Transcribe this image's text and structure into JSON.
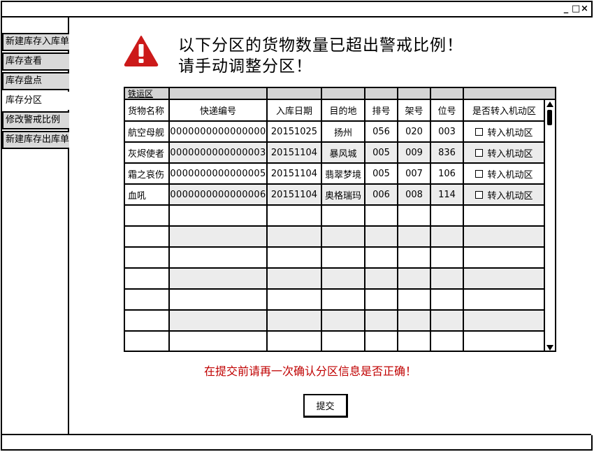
{
  "window": {
    "controls": {
      "minimize": "_",
      "maximize": "□",
      "close": "×"
    }
  },
  "sidebar": {
    "items": [
      {
        "label": "新建库存入库单",
        "active": false
      },
      {
        "label": "库存查看",
        "active": false
      },
      {
        "label": "库存盘点",
        "active": false
      },
      {
        "label": "库存分区",
        "active": true
      },
      {
        "label": "修改警戒比例",
        "active": false
      },
      {
        "label": "新建库存出库单",
        "active": false
      }
    ]
  },
  "alert": {
    "icon": "warning-icon",
    "icon_color": "#cc1a1a",
    "line1": "以下分区的货物数量已超出警戒比例！",
    "line2": "请手动调整分区！"
  },
  "table": {
    "region_label": "铁运区",
    "headers": [
      "货物名称",
      "快递编号",
      "入库日期",
      "目的地",
      "排号",
      "架号",
      "位号",
      "是否转入机动区"
    ],
    "rows": [
      {
        "name": "航空母舰",
        "code": "0000000000000000",
        "date": "20151025",
        "dest": "扬州",
        "row": "056",
        "shelf": "020",
        "pos": "003",
        "move_label": "转入机动区",
        "checked": false
      },
      {
        "name": "灰烬使者",
        "code": "0000000000000003",
        "date": "20151104",
        "dest": "暴风城",
        "row": "005",
        "shelf": "009",
        "pos": "836",
        "move_label": "转入机动区",
        "checked": false
      },
      {
        "name": "霜之哀伤",
        "code": "0000000000000005",
        "date": "20151104",
        "dest": "翡翠梦境",
        "row": "005",
        "shelf": "007",
        "pos": "106",
        "move_label": "转入机动区",
        "checked": false
      },
      {
        "name": "血吼",
        "code": "0000000000000006",
        "date": "20151104",
        "dest": "奥格瑞玛",
        "row": "006",
        "shelf": "008",
        "pos": "114",
        "move_label": "转入机动区",
        "checked": false
      }
    ],
    "empty_rows": 7,
    "alt_row_color": "#ececec"
  },
  "confirm_note": "在提交前请再一次确认分区信息是否正确！",
  "confirm_note_color": "#c00000",
  "submit_label": "提交"
}
